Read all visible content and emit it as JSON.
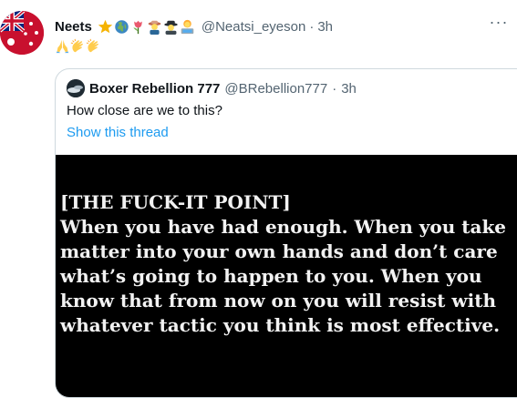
{
  "tweet": {
    "author_name": "Neets",
    "handle": "@Neatsi_eyeson",
    "separator": "·",
    "time": "3h",
    "more_label": "···",
    "name_emojis": [
      "star-emoji",
      "globe-emoji",
      "tulip-emoji",
      "farmer-emoji",
      "detective-emoji",
      "technologist-emoji"
    ],
    "reaction_emojis": [
      "folded-hands-emoji",
      "clapping-hands-emoji",
      "clapping-hands-emoji"
    ]
  },
  "quote": {
    "author_name": "Boxer Rebellion 777",
    "handle": "@BRebellion777",
    "separator": "·",
    "time": "3h",
    "text": "How close are we to this?",
    "show_thread_label": "Show this thread",
    "image_lines": [
      "[THE FUCK-IT POINT]",
      "When you have had enough. When you take",
      "matter into your own hands and don’t care",
      "what’s going to happen to you. When you",
      "know that from now on you will resist with",
      "whatever tactic you think is most effective."
    ]
  },
  "colors": {
    "text_primary": "#0f1419",
    "text_secondary": "#536471",
    "link": "#1d9bf0",
    "border": "#cfd9de",
    "media_bg": "#000000"
  }
}
